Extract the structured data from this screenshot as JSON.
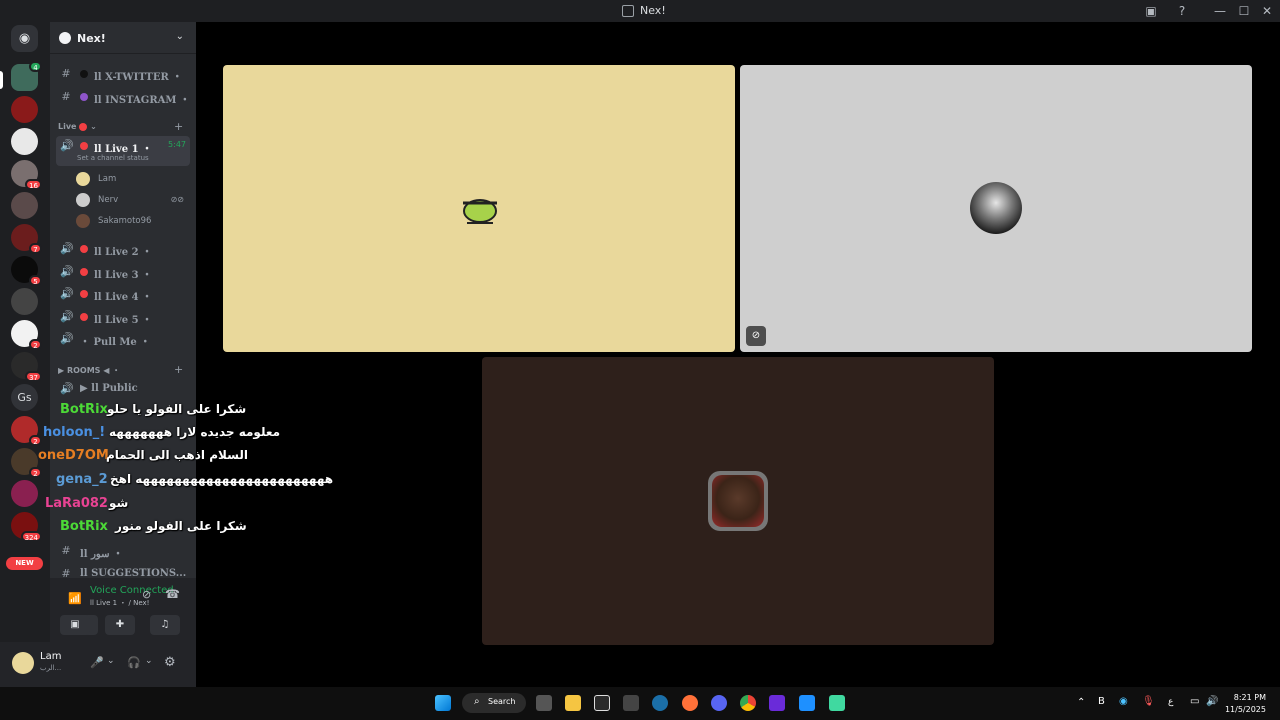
{
  "window": {
    "title": "Nex!"
  },
  "server": {
    "name": "Nex!"
  },
  "channels_top": [
    {
      "label": "ll X-TWITTER ・",
      "dot_color": "#111111"
    },
    {
      "label": "ll INSTAGRAM ・",
      "dot_color": "#8e55c9"
    }
  ],
  "live_category": {
    "label": "Live"
  },
  "live_channels": [
    {
      "label": "ll Live 1 ・",
      "timer": "5:47",
      "status": "Set a channel status"
    },
    {
      "label": "ll Live 2 ・"
    },
    {
      "label": "ll Live 3 ・"
    },
    {
      "label": "ll Live 4 ・"
    },
    {
      "label": "ll Live 5 ・"
    },
    {
      "label": "・ Pull Me ・"
    }
  ],
  "members": [
    {
      "name": "Lam"
    },
    {
      "name": "Nerv"
    },
    {
      "name": "Sakamoto96"
    }
  ],
  "rooms_category": {
    "label": "ROOMS ◀ ・"
  },
  "rooms_channels": [
    {
      "label": "▶ ll Public"
    }
  ],
  "text_channels_bottom": [
    {
      "label": "ll سور ・"
    },
    {
      "label": "ll SUGGESTIONS..."
    }
  ],
  "voice_panel": {
    "status": "Voice Connected",
    "channel": "ll Live 1 ・ / Nex!"
  },
  "user": {
    "name": "Lam",
    "sub": "الرب..."
  },
  "server_badges": [
    "4",
    "16",
    "7",
    "5",
    "2",
    "37",
    "2",
    "2",
    "324"
  ],
  "rail_text": {
    "gs": "Gs",
    "new": "NEW"
  },
  "chat": [
    {
      "user": "BotRix",
      "user_color": "#4cd937",
      "msg": "شكرا على الفولو يا حلو"
    },
    {
      "user": "holoon_!",
      "user_color": "#4a90e2",
      "msg": "معلومه جديده لارا هههههههه"
    },
    {
      "user": "oneD7OM",
      "user_color": "#e67e22",
      "msg": "السلام اذهب الى الحمام"
    },
    {
      "user": "gena_2",
      "user_color": "#5b9bd5",
      "msg": "ههههههههههههههههههههههههه اهخ"
    },
    {
      "user": "LaRa082",
      "user_color": "#e84393",
      "msg": "شو"
    },
    {
      "user": "BotRix",
      "user_color": "#4cd937",
      "msg": "شكرا على الفولو منور"
    }
  ],
  "taskbar": {
    "search_label": "Search",
    "time": "8:21 PM",
    "date": "11/5/2025",
    "lang": "ع"
  },
  "colors": {
    "live_red": "#f23f43",
    "voice_green": "#23a55a",
    "tile1": "#e9d89b",
    "tile2": "#cfcfcf",
    "tile3": "#2e201b"
  }
}
